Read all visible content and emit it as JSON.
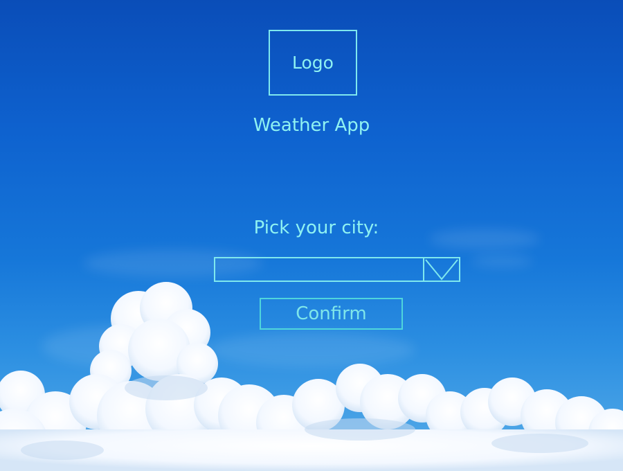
{
  "logo": {
    "label": "Logo"
  },
  "header": {
    "title": "Weather App"
  },
  "city_picker": {
    "label": "Pick your city:",
    "value": "",
    "placeholder": ""
  },
  "actions": {
    "confirm_label": "Confirm"
  },
  "colors": {
    "accent": "#8ff2f2",
    "sky_top": "#0a4db8",
    "sky_bottom": "#5aaee8",
    "cloud": "#ffffff"
  },
  "icons": {
    "dropdown": "chevron-down-icon"
  }
}
